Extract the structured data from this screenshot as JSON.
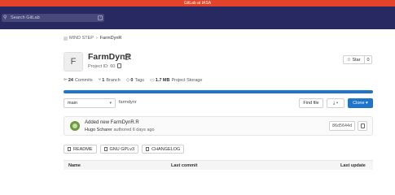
{
  "banner": {
    "text": "GitLab at IASA"
  },
  "topnav": {
    "search_placeholder": "Search GitLab",
    "search_shortcut": "/"
  },
  "breadcrumb": {
    "group": "MIND STEP",
    "project": "FarmDynR"
  },
  "project": {
    "avatar_letter": "F",
    "name": "FarmDynR",
    "id_label": "Project ID: 60",
    "star_label": "Star",
    "star_count": "0"
  },
  "stats": {
    "commits_count": "24",
    "commits_label": "Commits",
    "branches_count": "1",
    "branches_label": "Branch",
    "tags_count": "0",
    "tags_label": "Tags",
    "storage_size": "1.7 MB",
    "storage_label": "Project Storage"
  },
  "repo_bar": {
    "progress": 1.0
  },
  "toolbar": {
    "branch": "main",
    "path": "farmdynr",
    "find_file": "Find file",
    "download_icon": "download-icon",
    "clone": "Clone"
  },
  "commit": {
    "title": "Added new FarmDynR.R",
    "author": "Hugo Scharer",
    "authored_text": "authored 6 days ago",
    "sha": "86d5644d"
  },
  "file_buttons": [
    "README",
    "GNU GPLv3",
    "CHANGELOG"
  ],
  "table": {
    "col_name": "Name",
    "col_last_commit": "Last commit",
    "col_last_update": "Last update"
  },
  "colors": {
    "nav": "#292961",
    "banner": "#e24329",
    "accent": "#1f75cb"
  }
}
